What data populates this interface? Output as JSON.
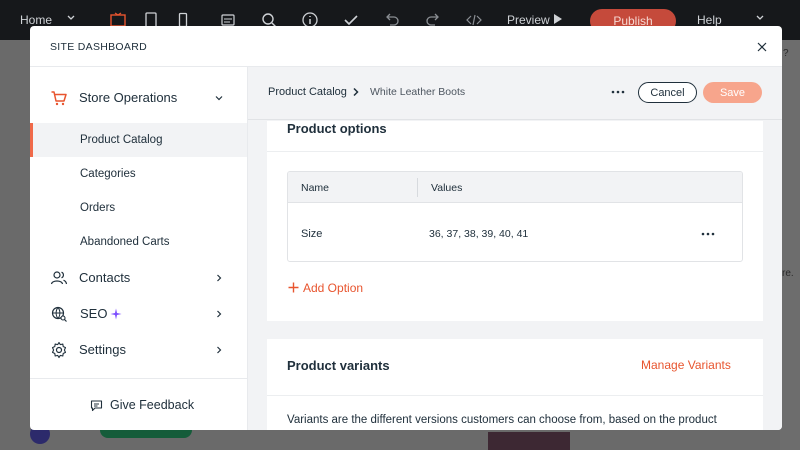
{
  "topbar": {
    "home": "Home",
    "preview": "Preview",
    "publish": "Publish",
    "help": "Help"
  },
  "background": {
    "qmark": "?",
    "re_fragment": "re."
  },
  "modal": {
    "title": "SITE DASHBOARD"
  },
  "sidebar": {
    "store_operations": "Store Operations",
    "sub_items": [
      "Product Catalog",
      "Categories",
      "Orders",
      "Abandoned Carts"
    ],
    "contacts": "Contacts",
    "seo": "SEO",
    "settings": "Settings",
    "feedback": "Give Feedback"
  },
  "main": {
    "breadcrumb": {
      "parent": "Product Catalog",
      "current": "White Leather Boots"
    },
    "cancel": "Cancel",
    "save": "Save",
    "options": {
      "title": "Product options",
      "col_name": "Name",
      "col_values": "Values",
      "row_name": "Size",
      "row_values": "36, 37, 38, 39, 40, 41",
      "add_option": "Add Option"
    },
    "variants": {
      "title": "Product variants",
      "manage": "Manage Variants",
      "description": "Variants are the different versions customers can choose from, based on the product"
    }
  },
  "colors": {
    "accent": "#e8552f",
    "save_bg": "#f7a58c",
    "publish_bg": "#c54a3b"
  }
}
